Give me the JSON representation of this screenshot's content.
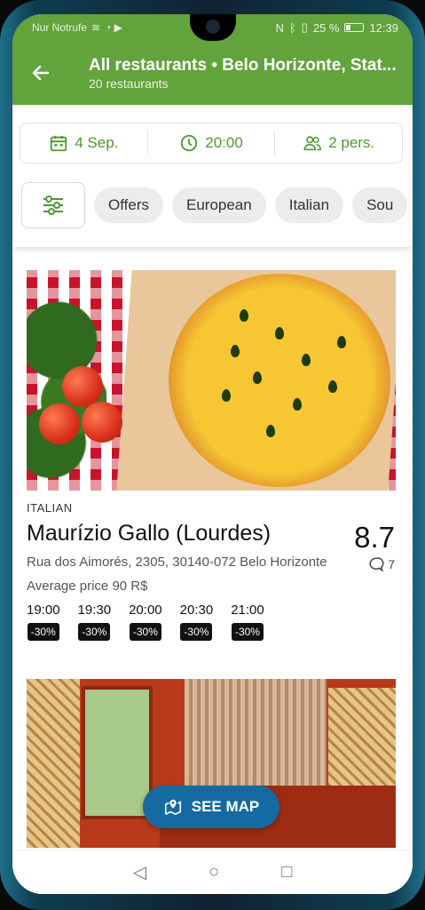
{
  "status_bar": {
    "carrier": "Nur Notrufe",
    "battery": "25 %",
    "time": "12:39"
  },
  "header": {
    "back_icon": "arrow-left-icon",
    "title": "All restaurants • Belo Horizonte, Stat...",
    "subtitle": "20 restaurants",
    "color": "#62a33c"
  },
  "booking": {
    "date": "4 Sep.",
    "time": "20:00",
    "persons": "2 pers.",
    "accent": "#4b9a2e"
  },
  "chips": [
    "Offers",
    "European",
    "Italian",
    "Sou"
  ],
  "restaurants": [
    {
      "cuisine": "ITALIAN",
      "name": "Maurízio Gallo (Lourdes)",
      "rating": "8.7",
      "reviews": "7",
      "address": "Rua dos Aimorés, 2305, 30140-072 Belo Horizonte",
      "price": "Average price 90 R$",
      "slots": [
        {
          "time": "19:00",
          "discount": "-30%"
        },
        {
          "time": "19:30",
          "discount": "-30%"
        },
        {
          "time": "20:00",
          "discount": "-30%"
        },
        {
          "time": "20:30",
          "discount": "-30%"
        },
        {
          "time": "21:00",
          "discount": "-30%"
        }
      ]
    }
  ],
  "map_button": {
    "label": "SEE MAP",
    "color": "#156aa2"
  }
}
